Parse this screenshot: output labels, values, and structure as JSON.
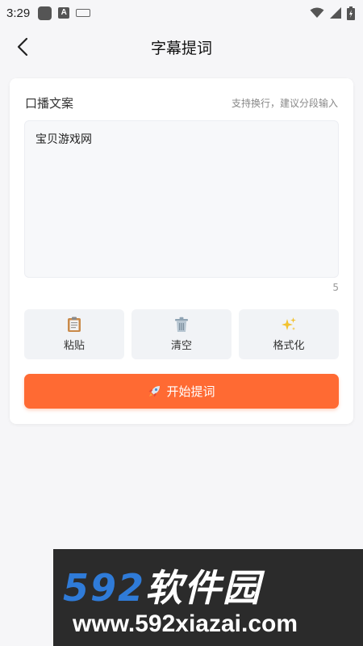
{
  "status_bar": {
    "time": "3:29",
    "keyboard_icon": "keyboard-icon",
    "a_icon_text": "A"
  },
  "header": {
    "title": "字幕提词",
    "back_icon": "chevron-left-icon"
  },
  "editor": {
    "label": "口播文案",
    "hint": "支持换行，建议分段输入",
    "content": "宝贝游戏网",
    "char_count": "5"
  },
  "actions": [
    {
      "label": "粘贴",
      "icon": "clipboard-icon"
    },
    {
      "label": "清空",
      "icon": "trash-icon"
    },
    {
      "label": "格式化",
      "icon": "sparkles-icon"
    }
  ],
  "start_button": {
    "label": "开始提词",
    "icon": "rocket-icon"
  },
  "watermark": {
    "logo_num": "592",
    "logo_cn": "软件园",
    "url": "www.592xiazai.com"
  },
  "colors": {
    "accent": "#ff6a33",
    "background": "#f6f6f8",
    "card": "#ffffff",
    "watermark_blue": "#2f7bd8"
  }
}
